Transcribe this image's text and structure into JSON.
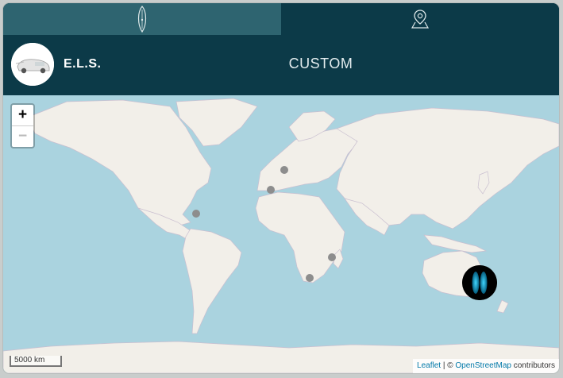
{
  "brand": {
    "name": "E.L.S."
  },
  "page": {
    "title": "CUSTOM"
  },
  "map": {
    "zoom_in_label": "+",
    "zoom_out_label": "−",
    "scale_label": "5000 km",
    "attribution": {
      "leaflet": "Leaflet",
      "separator": " | © ",
      "osm": "OpenStreetMap",
      "suffix": " contributors"
    }
  },
  "colors": {
    "header": "#0c3a48",
    "tab_inactive": "#2e6470",
    "water": "#aad3df",
    "land": "#f2efe9",
    "marker": "#8d8d8d"
  },
  "icons": {
    "tab_1": "surfboard-icon",
    "tab_2": "map-pin-icon"
  }
}
